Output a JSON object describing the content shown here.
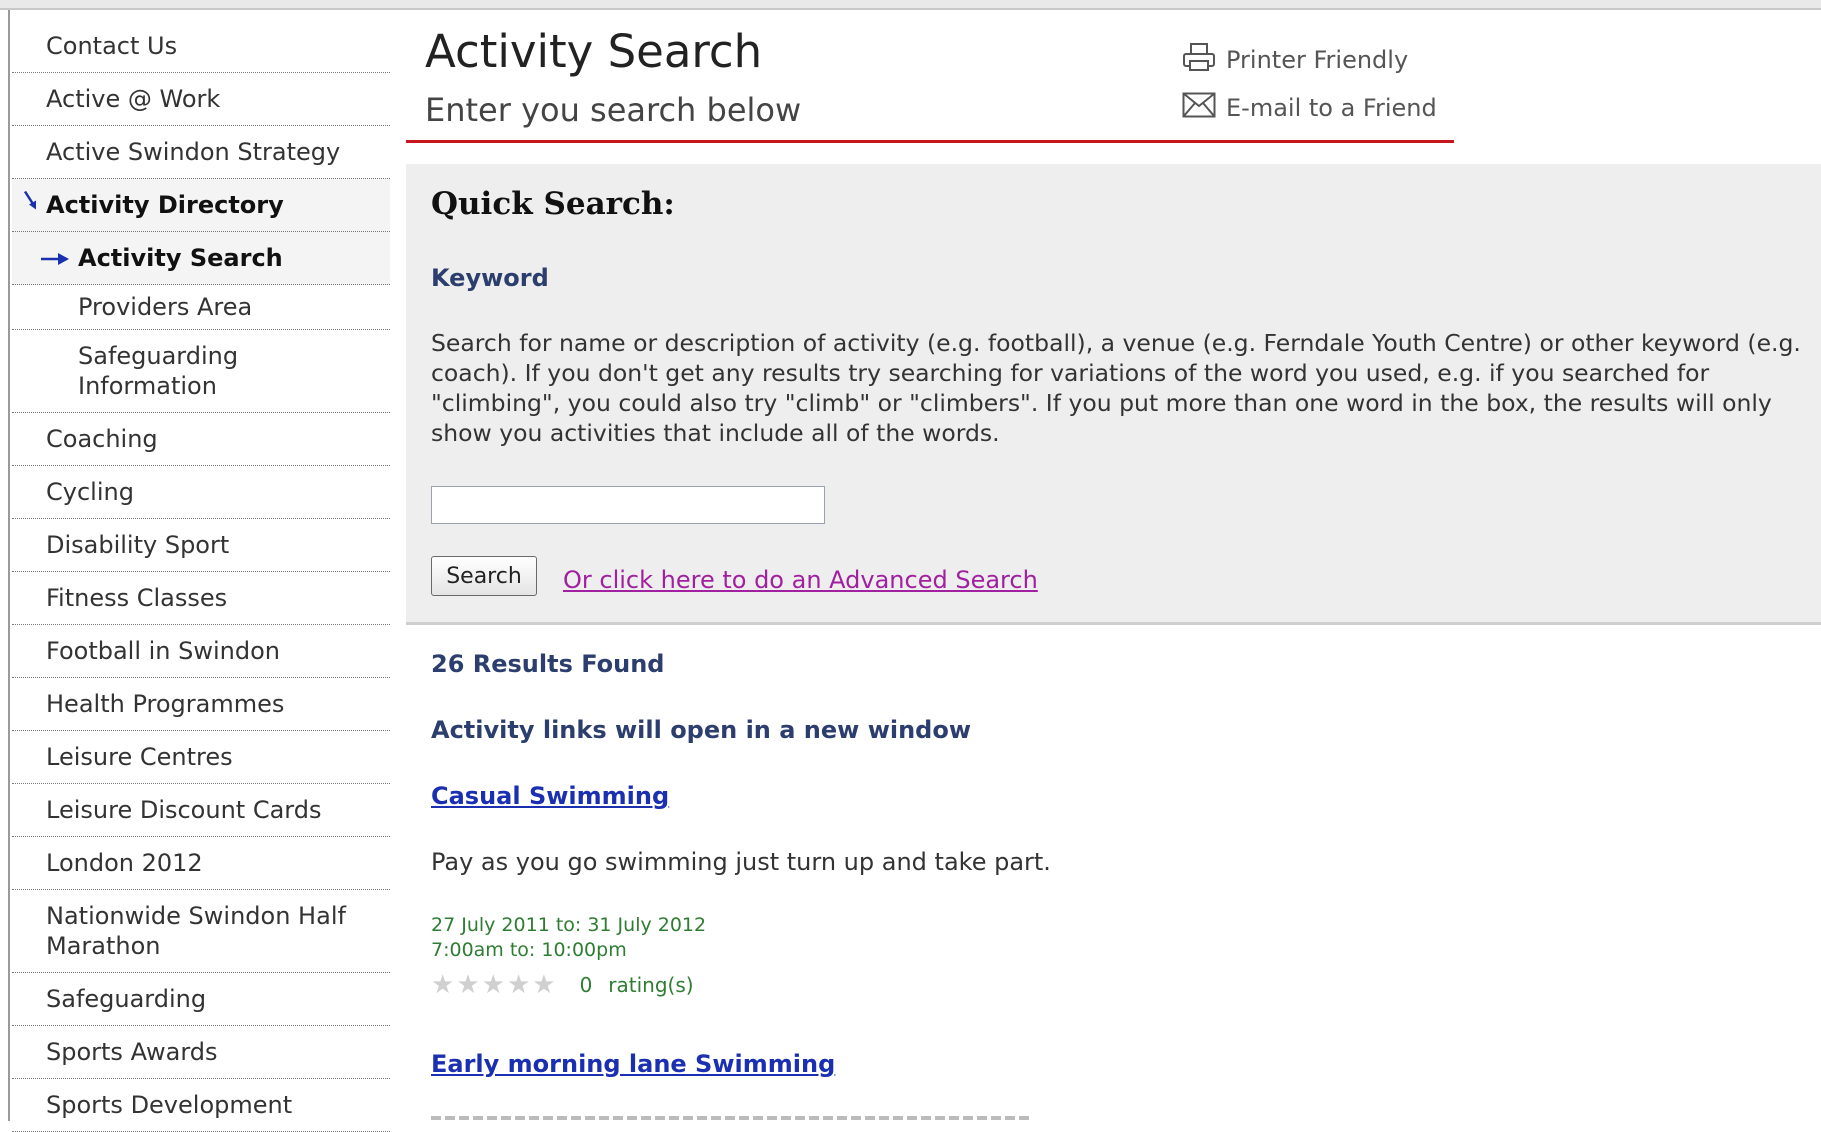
{
  "sidebar": {
    "items": [
      {
        "label": "Contact Us"
      },
      {
        "label": "Active @ Work"
      },
      {
        "label": "Active Swindon Strategy"
      },
      {
        "label": "Activity Directory"
      },
      {
        "label": "Activity Search"
      },
      {
        "label": "Providers Area"
      },
      {
        "label": "Safeguarding Information"
      },
      {
        "label": "Coaching"
      },
      {
        "label": "Cycling"
      },
      {
        "label": "Disability Sport"
      },
      {
        "label": "Fitness Classes"
      },
      {
        "label": "Football in Swindon"
      },
      {
        "label": "Health Programmes"
      },
      {
        "label": "Leisure Centres"
      },
      {
        "label": "Leisure Discount Cards"
      },
      {
        "label": "London 2012"
      },
      {
        "label": "Nationwide Swindon Half Marathon"
      },
      {
        "label": "Safeguarding"
      },
      {
        "label": "Sports Awards"
      },
      {
        "label": "Sports Development"
      }
    ]
  },
  "header": {
    "title": "Activity Search",
    "subtitle": "Enter you search below",
    "printer_friendly": "Printer Friendly",
    "email_friend": "E-mail to a Friend",
    "accent_color": "#c8161d"
  },
  "quick_search": {
    "heading": "Quick Search:",
    "keyword_label": "Keyword",
    "description": "Search for name or description of activity (e.g. football), a venue (e.g. Ferndale Youth Centre) or other keyword (e.g. coach). If you don't get any results try searching for variations of the word you used, e.g. if you searched for \"climbing\", you could also try \"climb\" or \"climbers\". If you put more than one word in the box, the results will only show you activities that include all of the words.",
    "input_value": "",
    "search_button": "Search",
    "advanced_link": "Or click here to do an Advanced Search"
  },
  "results": {
    "count_text": "26 Results Found",
    "new_window_note": "Activity links will open in a new window",
    "items": [
      {
        "title": "Casual Swimming",
        "description": "Pay as you go swimming just turn up and take part.",
        "dates": "27 July 2011 to: 31 July 2012",
        "times": "7:00am to: 10:00pm",
        "rating_count": "0",
        "rating_label": "rating(s)",
        "stars_filled": 0,
        "stars_total": 5
      },
      {
        "title": "Early morning lane Swimming"
      }
    ]
  }
}
